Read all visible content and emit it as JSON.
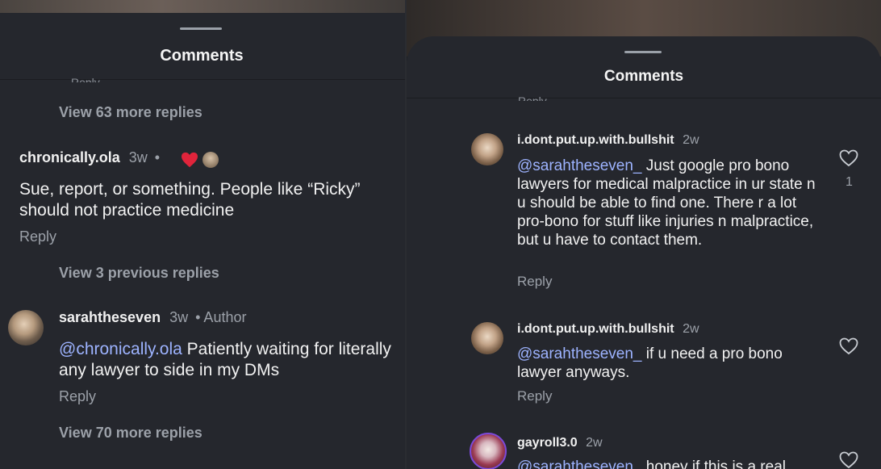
{
  "left": {
    "title": "Comments",
    "top_reply_clip": "Reply",
    "view_more_top": "View 63 more replies",
    "comment1": {
      "username": "chronically.ola",
      "time": "3w",
      "dot": "•",
      "text": "Sue, report, or something. People like “Ricky” should not practice medicine",
      "reply": "Reply"
    },
    "view_previous": "View 3 previous replies",
    "comment2": {
      "username": "sarahtheseven",
      "time": "3w",
      "author_tag": "• Author",
      "mention": "@chronically.ola",
      "text": " Patiently waiting for literally any lawyer to side in my DMs",
      "reply": "Reply"
    },
    "view_more_bottom": "View 70 more replies"
  },
  "right": {
    "title": "Comments",
    "top_reply_clip": "Reply",
    "comment1": {
      "username": "i.dont.put.up.with.bullshit",
      "time": "2w",
      "mention": "@sarahtheseven_",
      "text": " Just google pro bono lawyers for medical malpractice in ur state n u should be able to find one. There r a lot pro-bono for stuff like injuries n malpractice, but u have to contact them.",
      "reply": "Reply",
      "likes": "1"
    },
    "comment2": {
      "username": "i.dont.put.up.with.bullshit",
      "time": "2w",
      "mention": "@sarahtheseven_",
      "text": " if u need a pro bono lawyer anyways.",
      "reply": "Reply"
    },
    "comment3": {
      "username": "gayroll3.0",
      "time": "2w",
      "mention": "@sarahtheseven_",
      "text": " honey if this is a real"
    }
  },
  "colors": {
    "accent_mention": "#9db3ff",
    "like_heart": "#e0243b",
    "background": "#25272d"
  },
  "icons": [
    "heart-icon",
    "heart-outline-icon"
  ]
}
